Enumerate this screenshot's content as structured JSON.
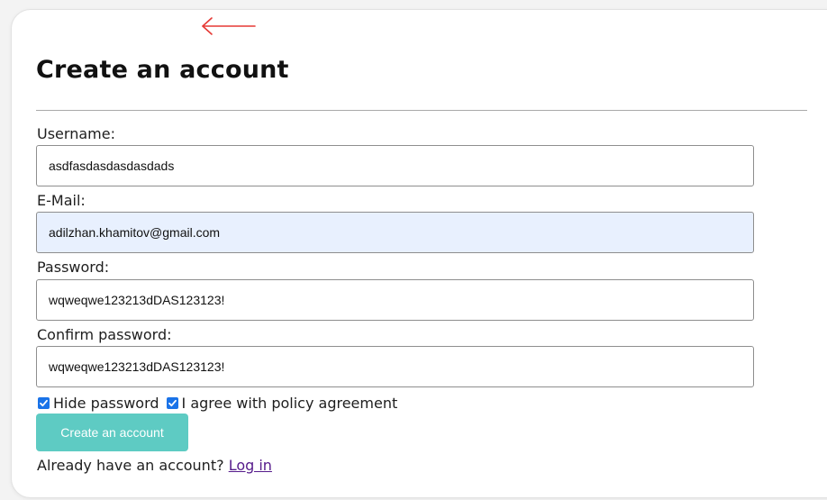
{
  "form": {
    "title": "Create an account",
    "back_icon": "left-arrow-icon",
    "fields": {
      "username": {
        "label": "Username:",
        "value": "asdfasdasdasdasdads"
      },
      "email": {
        "label": "E-Mail:",
        "value": "adilzhan.khamitov@gmail.com"
      },
      "password": {
        "label": "Password:",
        "value": "wqweqwe123213dDAS123123!"
      },
      "confirm": {
        "label": "Confirm password:",
        "value": "wqweqwe123213dDAS123123!"
      }
    },
    "options": {
      "hide_password": {
        "label": "Hide password",
        "checked": true
      },
      "policy": {
        "label": "I agree with policy agreement",
        "checked": true
      }
    },
    "submit_label": "Create an account",
    "login_prompt": "Already have an account?",
    "login_link": "Log in"
  },
  "colors": {
    "accent_button": "#5ecbc3",
    "checkbox": "#1a73e8",
    "autofill_bg": "#e8f0fe",
    "back_arrow": "#e53935",
    "link": "#551a8b"
  }
}
